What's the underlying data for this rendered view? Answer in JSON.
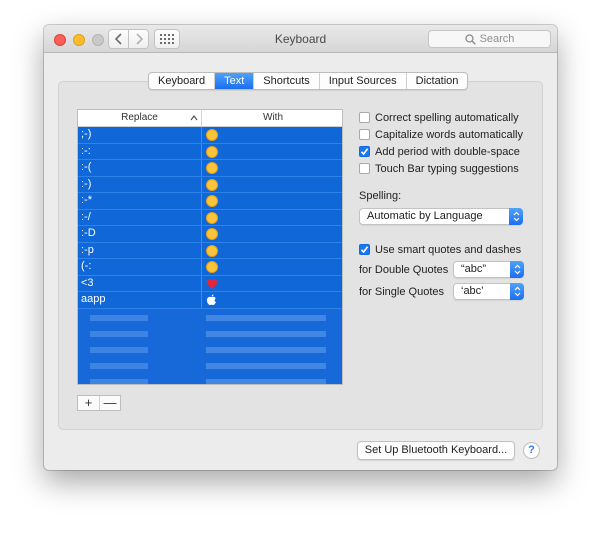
{
  "window": {
    "title": "Keyboard",
    "search_placeholder": "Search"
  },
  "tabs": [
    {
      "label": "Keyboard",
      "active": false
    },
    {
      "label": "Text",
      "active": true
    },
    {
      "label": "Shortcuts",
      "active": false
    },
    {
      "label": "Input Sources",
      "active": false
    },
    {
      "label": "Dictation",
      "active": false
    }
  ],
  "table": {
    "columns": {
      "replace": "Replace",
      "with": "With"
    },
    "rows": [
      {
        "replace": ";-)",
        "with_icon": "winking-face-emoji"
      },
      {
        "replace": ":-:",
        "with_icon": "relieved-face-emoji"
      },
      {
        "replace": ":-(",
        "with_icon": "disappointed-face-emoji"
      },
      {
        "replace": ":-)",
        "with_icon": "smiling-face-emoji"
      },
      {
        "replace": ":-*",
        "with_icon": "kissing-face-emoji"
      },
      {
        "replace": ":-/",
        "with_icon": "confused-face-emoji"
      },
      {
        "replace": ":-D",
        "with_icon": "grinning-face-emoji"
      },
      {
        "replace": ":-p",
        "with_icon": "tongue-face-emoji"
      },
      {
        "replace": "(-:",
        "with_icon": "upside-down-face-emoji"
      },
      {
        "replace": "<3",
        "with_icon": "red-heart-emoji"
      },
      {
        "replace": "aapp",
        "with_icon": "apple-logo-icon"
      }
    ]
  },
  "buttons": {
    "add": "+",
    "remove": "—",
    "bluetooth": "Set Up Bluetooth Keyboard...",
    "help": "?"
  },
  "options": [
    {
      "label": "Correct spelling automatically",
      "checked": false
    },
    {
      "label": "Capitalize words automatically",
      "checked": false
    },
    {
      "label": "Add period with double-space",
      "checked": true
    },
    {
      "label": "Touch Bar typing suggestions",
      "checked": false
    }
  ],
  "spelling": {
    "label": "Spelling:",
    "value": "Automatic by Language"
  },
  "smart_quotes": {
    "label": "Use smart quotes and dashes",
    "checked": true
  },
  "double_quotes": {
    "label": "for Double Quotes",
    "value": "“abc”"
  },
  "single_quotes": {
    "label": "for Single Quotes",
    "value": "‘abc’"
  },
  "colors": {
    "accent": "#1b6ef0",
    "selection": "#0f67d8",
    "heart": "#e4253a"
  }
}
